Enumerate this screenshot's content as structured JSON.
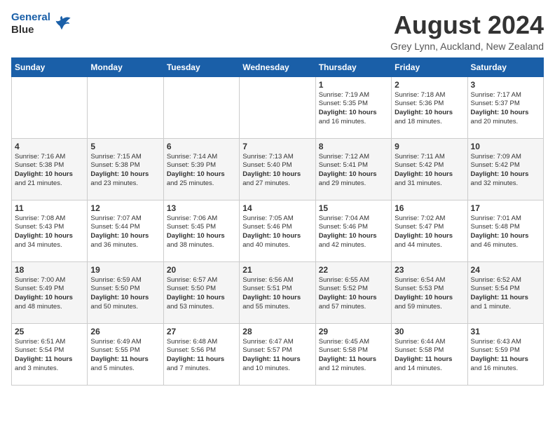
{
  "header": {
    "logo_line1": "General",
    "logo_line2": "Blue",
    "month_year": "August 2024",
    "location": "Grey Lynn, Auckland, New Zealand"
  },
  "weekdays": [
    "Sunday",
    "Monday",
    "Tuesday",
    "Wednesday",
    "Thursday",
    "Friday",
    "Saturday"
  ],
  "weeks": [
    [
      {
        "day": "",
        "content": ""
      },
      {
        "day": "",
        "content": ""
      },
      {
        "day": "",
        "content": ""
      },
      {
        "day": "",
        "content": ""
      },
      {
        "day": "1",
        "content": "Sunrise: 7:19 AM\nSunset: 5:35 PM\nDaylight: 10 hours\nand 16 minutes."
      },
      {
        "day": "2",
        "content": "Sunrise: 7:18 AM\nSunset: 5:36 PM\nDaylight: 10 hours\nand 18 minutes."
      },
      {
        "day": "3",
        "content": "Sunrise: 7:17 AM\nSunset: 5:37 PM\nDaylight: 10 hours\nand 20 minutes."
      }
    ],
    [
      {
        "day": "4",
        "content": "Sunrise: 7:16 AM\nSunset: 5:38 PM\nDaylight: 10 hours\nand 21 minutes."
      },
      {
        "day": "5",
        "content": "Sunrise: 7:15 AM\nSunset: 5:38 PM\nDaylight: 10 hours\nand 23 minutes."
      },
      {
        "day": "6",
        "content": "Sunrise: 7:14 AM\nSunset: 5:39 PM\nDaylight: 10 hours\nand 25 minutes."
      },
      {
        "day": "7",
        "content": "Sunrise: 7:13 AM\nSunset: 5:40 PM\nDaylight: 10 hours\nand 27 minutes."
      },
      {
        "day": "8",
        "content": "Sunrise: 7:12 AM\nSunset: 5:41 PM\nDaylight: 10 hours\nand 29 minutes."
      },
      {
        "day": "9",
        "content": "Sunrise: 7:11 AM\nSunset: 5:42 PM\nDaylight: 10 hours\nand 31 minutes."
      },
      {
        "day": "10",
        "content": "Sunrise: 7:09 AM\nSunset: 5:42 PM\nDaylight: 10 hours\nand 32 minutes."
      }
    ],
    [
      {
        "day": "11",
        "content": "Sunrise: 7:08 AM\nSunset: 5:43 PM\nDaylight: 10 hours\nand 34 minutes."
      },
      {
        "day": "12",
        "content": "Sunrise: 7:07 AM\nSunset: 5:44 PM\nDaylight: 10 hours\nand 36 minutes."
      },
      {
        "day": "13",
        "content": "Sunrise: 7:06 AM\nSunset: 5:45 PM\nDaylight: 10 hours\nand 38 minutes."
      },
      {
        "day": "14",
        "content": "Sunrise: 7:05 AM\nSunset: 5:46 PM\nDaylight: 10 hours\nand 40 minutes."
      },
      {
        "day": "15",
        "content": "Sunrise: 7:04 AM\nSunset: 5:46 PM\nDaylight: 10 hours\nand 42 minutes."
      },
      {
        "day": "16",
        "content": "Sunrise: 7:02 AM\nSunset: 5:47 PM\nDaylight: 10 hours\nand 44 minutes."
      },
      {
        "day": "17",
        "content": "Sunrise: 7:01 AM\nSunset: 5:48 PM\nDaylight: 10 hours\nand 46 minutes."
      }
    ],
    [
      {
        "day": "18",
        "content": "Sunrise: 7:00 AM\nSunset: 5:49 PM\nDaylight: 10 hours\nand 48 minutes."
      },
      {
        "day": "19",
        "content": "Sunrise: 6:59 AM\nSunset: 5:50 PM\nDaylight: 10 hours\nand 50 minutes."
      },
      {
        "day": "20",
        "content": "Sunrise: 6:57 AM\nSunset: 5:50 PM\nDaylight: 10 hours\nand 53 minutes."
      },
      {
        "day": "21",
        "content": "Sunrise: 6:56 AM\nSunset: 5:51 PM\nDaylight: 10 hours\nand 55 minutes."
      },
      {
        "day": "22",
        "content": "Sunrise: 6:55 AM\nSunset: 5:52 PM\nDaylight: 10 hours\nand 57 minutes."
      },
      {
        "day": "23",
        "content": "Sunrise: 6:54 AM\nSunset: 5:53 PM\nDaylight: 10 hours\nand 59 minutes."
      },
      {
        "day": "24",
        "content": "Sunrise: 6:52 AM\nSunset: 5:54 PM\nDaylight: 11 hours\nand 1 minute."
      }
    ],
    [
      {
        "day": "25",
        "content": "Sunrise: 6:51 AM\nSunset: 5:54 PM\nDaylight: 11 hours\nand 3 minutes."
      },
      {
        "day": "26",
        "content": "Sunrise: 6:49 AM\nSunset: 5:55 PM\nDaylight: 11 hours\nand 5 minutes."
      },
      {
        "day": "27",
        "content": "Sunrise: 6:48 AM\nSunset: 5:56 PM\nDaylight: 11 hours\nand 7 minutes."
      },
      {
        "day": "28",
        "content": "Sunrise: 6:47 AM\nSunset: 5:57 PM\nDaylight: 11 hours\nand 10 minutes."
      },
      {
        "day": "29",
        "content": "Sunrise: 6:45 AM\nSunset: 5:58 PM\nDaylight: 11 hours\nand 12 minutes."
      },
      {
        "day": "30",
        "content": "Sunrise: 6:44 AM\nSunset: 5:58 PM\nDaylight: 11 hours\nand 14 minutes."
      },
      {
        "day": "31",
        "content": "Sunrise: 6:43 AM\nSunset: 5:59 PM\nDaylight: 11 hours\nand 16 minutes."
      }
    ]
  ]
}
